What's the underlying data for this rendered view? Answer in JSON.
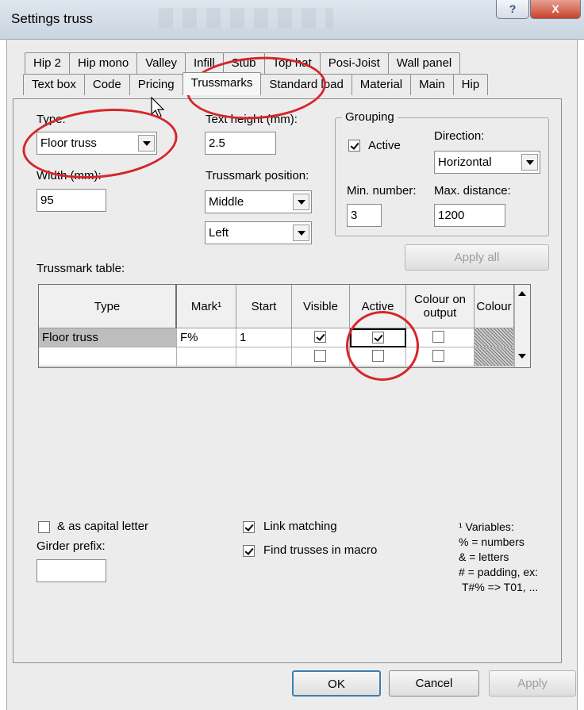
{
  "window": {
    "title": "Settings truss",
    "help_label": "?",
    "close_label": "X"
  },
  "tabs_top": [
    "Hip 2",
    "Hip mono",
    "Valley",
    "Infill",
    "Stub",
    "Top hat",
    "Posi-Joist",
    "Wall panel"
  ],
  "tabs_bottom": [
    "Text box",
    "Code",
    "Pricing",
    "Trussmarks",
    "Standard load",
    "Material",
    "Main",
    "Hip"
  ],
  "active_tab": "Trussmarks",
  "form": {
    "type_label": "Type:",
    "type_value": "Floor truss",
    "width_label": "Width (mm):",
    "width_value": "95",
    "text_height_label": "Text height (mm):",
    "text_height_value": "2.5",
    "position_label": "Trussmark position:",
    "position_value": "Middle",
    "align_value": "Left"
  },
  "grouping": {
    "legend": "Grouping",
    "active_label": "Active",
    "active_checked": true,
    "direction_label": "Direction:",
    "direction_value": "Horizontal",
    "min_number_label": "Min. number:",
    "min_number_value": "3",
    "max_distance_label": "Max. distance:",
    "max_distance_value": "1200"
  },
  "apply_all_label": "Apply all",
  "table": {
    "label": "Trussmark table:",
    "headers": [
      "Type",
      "Mark¹",
      "Start",
      "Visible",
      "Active",
      "Colour on output",
      "Colour"
    ],
    "rows": [
      {
        "type": "Floor truss",
        "mark": "F%",
        "start": "1",
        "visible": true,
        "active": true,
        "colour_on_output": false
      },
      {
        "type": "",
        "mark": "",
        "start": "",
        "visible": false,
        "active": false,
        "colour_on_output": false
      }
    ]
  },
  "options": {
    "capital_label": "& as capital letter",
    "capital_checked": false,
    "girder_prefix_label": "Girder prefix:",
    "girder_prefix_value": "",
    "link_matching_label": "Link matching",
    "link_matching_checked": true,
    "find_trusses_label": "Find trusses in macro",
    "find_trusses_checked": true
  },
  "variables": {
    "title": "¹ Variables:",
    "lines": [
      "% = numbers",
      "& = letters",
      "# = padding, ex:",
      "T#% => T01, ..."
    ]
  },
  "buttons": {
    "ok": "OK",
    "cancel": "Cancel",
    "apply": "Apply"
  },
  "colors": {
    "annotation": "#d6262b",
    "title_bar": "#c9d4e0",
    "dialog_bg": "#ececec"
  }
}
